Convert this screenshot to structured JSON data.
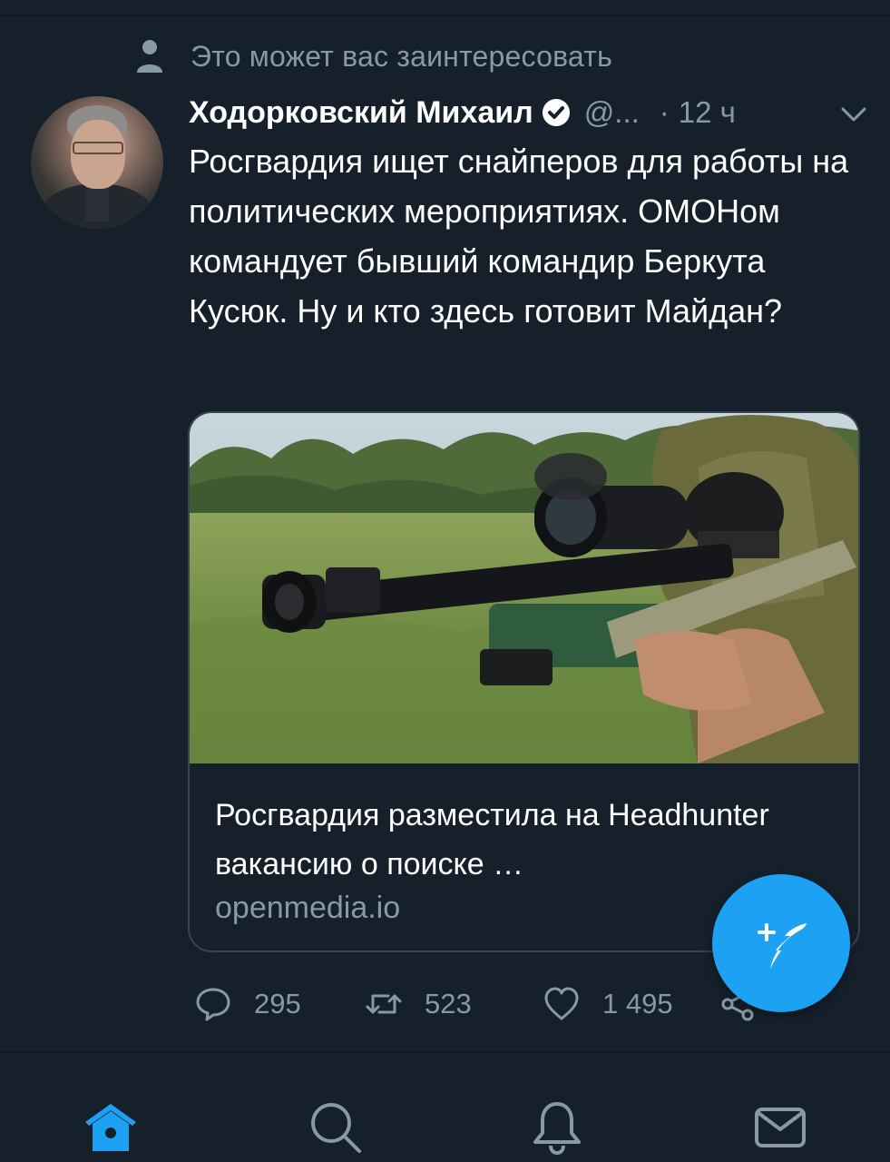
{
  "context": {
    "icon": "person-icon",
    "text": "Это может вас заинтересовать"
  },
  "tweet": {
    "author_name": "Ходорковский Михаил",
    "verified": true,
    "handle": "@...",
    "dot": "·",
    "time": "12 ч",
    "text": "Росгвардия ищет снайперов для работы на политических мероприятиях. ОМОНом командует бывший командир Беркута Кусюк. Ну и кто здесь готовит Майдан?",
    "card": {
      "image": "sniper-rifle-photo",
      "title": "Росгвардия разместила на Headhunter вакансию о поиске …",
      "domain": "openmedia.io"
    },
    "actions": {
      "replies": "295",
      "retweets": "523",
      "likes": "1 495"
    }
  },
  "fab": {
    "icon": "compose-tweet-icon"
  },
  "bottom_nav": [
    {
      "name": "home",
      "icon": "home-icon",
      "active": true
    },
    {
      "name": "search",
      "icon": "search-icon",
      "active": false
    },
    {
      "name": "notifications",
      "icon": "bell-icon",
      "active": false
    },
    {
      "name": "messages",
      "icon": "mail-icon",
      "active": false
    }
  ],
  "colors": {
    "background": "#15202b",
    "secondary_text": "#8899a6",
    "accent": "#1da1f2",
    "border": "#38444d"
  }
}
